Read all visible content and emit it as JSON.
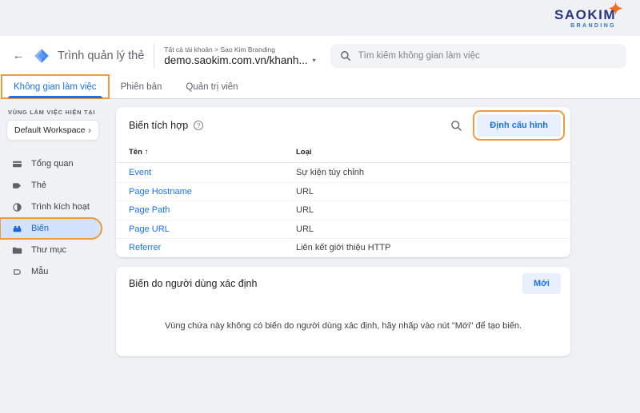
{
  "brand": {
    "name": "SAOKIM",
    "tagline": "BRANDING"
  },
  "icons": {
    "back": "←",
    "caret_down": "▾",
    "chevron_right": "›",
    "sort_asc": "↑",
    "help": "?"
  },
  "header": {
    "app_title": "Trình quản lý thẻ",
    "breadcrumb": "Tất cả tài khoản > Sao Kim Branding",
    "container_name": "demo.saokim.com.vn/khanh...",
    "search_placeholder": "Tìm kiếm không gian làm việc"
  },
  "tabs": [
    {
      "label": "Không gian làm việc",
      "active": true
    },
    {
      "label": "Phiên bản",
      "active": false
    },
    {
      "label": "Quản trị viên",
      "active": false
    }
  ],
  "sidebar": {
    "section_label": "VÙNG LÀM VIỆC HIỆN TẠI",
    "workspace_name": "Default Workspace",
    "items": [
      {
        "label": "Tổng quan",
        "selected": false
      },
      {
        "label": "Thẻ",
        "selected": false
      },
      {
        "label": "Trình kích hoạt",
        "selected": false
      },
      {
        "label": "Biến",
        "selected": true
      },
      {
        "label": "Thư mục",
        "selected": false
      },
      {
        "label": "Mẫu",
        "selected": false
      }
    ]
  },
  "builtin_card": {
    "title": "Biến tích hợp",
    "configure_label": "Định cấu hình",
    "columns": {
      "name": "Tên",
      "type": "Loại"
    },
    "rows": [
      {
        "name": "Event",
        "type": "Sự kiện tùy chỉnh"
      },
      {
        "name": "Page Hostname",
        "type": "URL"
      },
      {
        "name": "Page Path",
        "type": "URL"
      },
      {
        "name": "Page URL",
        "type": "URL"
      },
      {
        "name": "Referrer",
        "type": "Liên kết giới thiệu HTTP"
      }
    ]
  },
  "user_card": {
    "title": "Biến do người dùng xác định",
    "new_label": "Mới",
    "empty_text": "Vùng chứa này không có biến do người dùng xác định, hãy nhấp vào nút \"Mới\" để tạo biến."
  },
  "colors": {
    "accent_blue": "#1a73e8",
    "selected_pill_blue": "#d3e3fd",
    "chip_button_bg": "#e8f0fe",
    "annotation_orange": "#ef9b3c",
    "brand_navy": "#283583",
    "brand_blue": "#2e74b5",
    "star_orange": "#f26c1f",
    "page_bg": "#f0f1f4"
  }
}
